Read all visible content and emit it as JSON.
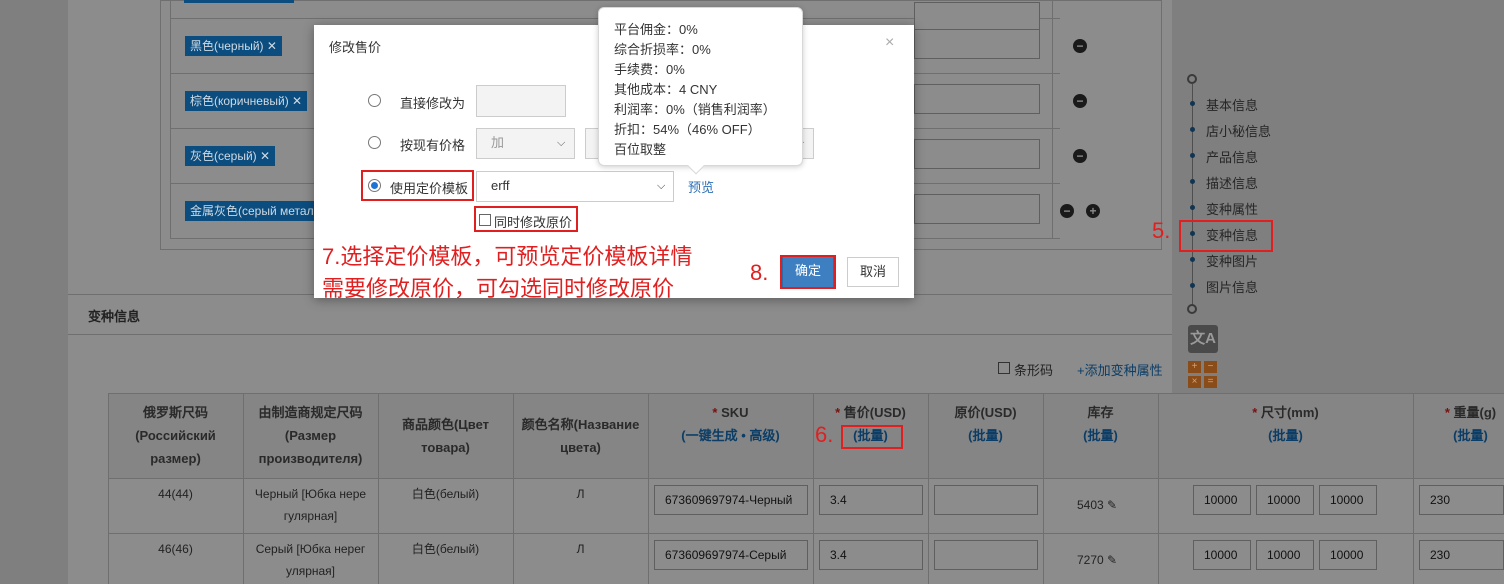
{
  "colors": {
    "accent": "#3d7fc1",
    "link": "#2c6fb5",
    "annotation": "#e02020",
    "tag_bg": "#0b4d7f",
    "overlay": "#7f7f7f"
  },
  "color_tags": [
    {
      "label": "黑色(черный)"
    },
    {
      "label": "棕色(коричневый)"
    },
    {
      "label": "灰色(серый)"
    },
    {
      "label": "金属灰色(серый метал"
    }
  ],
  "side_nav": {
    "items": [
      "基本信息",
      "店小秘信息",
      "产品信息",
      "描述信息",
      "变种属性",
      "变种信息",
      "变种图片",
      "图片信息"
    ],
    "active": "变种信息"
  },
  "variant_section": {
    "title": "变种信息",
    "barcode_label": "条形码",
    "add_attr_link": "+添加变种属性",
    "headers": [
      {
        "lines": [
          "俄罗斯尺码",
          "(Российский",
          "размер)"
        ]
      },
      {
        "lines": [
          "由制造商规定尺码",
          "(Размер",
          "производителя)"
        ]
      },
      {
        "lines": [
          "商品颜色(Цвет",
          "товара)"
        ]
      },
      {
        "lines": [
          "颜色名称(Название",
          "цвета)"
        ]
      },
      {
        "req": "*",
        "label": "SKU",
        "sub_a": "一键生成",
        "sep": "•",
        "sub_b": "高级",
        "open": "(",
        "close": ")"
      },
      {
        "req": "*",
        "label": "售价(USD)",
        "sub": "(批量)"
      },
      {
        "label": "原价(USD)",
        "sub": "(批量)"
      },
      {
        "label": "库存",
        "sub": "(批量)"
      },
      {
        "req": "*",
        "label": "尺寸(mm)",
        "sub": "(批量)"
      },
      {
        "req": "*",
        "label": "重量(g)",
        "sub": "(批量)"
      }
    ],
    "rows": [
      {
        "ru_size": "44(44)",
        "maker_size": [
          "Черный [Юбка нере",
          "гулярная]"
        ],
        "color": "白色(белый)",
        "color_name": "Л",
        "sku": "673609697974-Черный",
        "price": "3.4",
        "original": "",
        "stock": "5403",
        "dims": [
          "10000",
          "10000",
          "10000"
        ],
        "weight": "230"
      },
      {
        "ru_size": "46(46)",
        "maker_size": [
          "Серый [Юбка нерег",
          "улярная]"
        ],
        "color": "白色(белый)",
        "color_name": "Л",
        "sku": "673609697974-Серый",
        "price": "3.4",
        "original": "",
        "stock": "7270",
        "dims": [
          "10000",
          "10000",
          "10000"
        ],
        "weight": "230"
      }
    ]
  },
  "modal": {
    "title": "修改售价",
    "close": "×",
    "option_direct": "直接修改为",
    "option_existing": "按现有价格",
    "existing_op": "加",
    "option_template": "使用定价模板",
    "template_value": "erff",
    "preview_link": "预览",
    "also_original": "同时修改原价",
    "ok": "确定",
    "cancel": "取消"
  },
  "tooltip": {
    "lines": [
      "平台佣金：0%",
      "综合折损率：0%",
      "手续费：0%",
      "其他成本：4 CNY",
      "利润率：0%（销售利润率）",
      "折扣：54%（46% OFF）",
      "百位取整"
    ]
  },
  "annotations": {
    "step5": "5.",
    "step6": "6.",
    "step7_line1": "7.选择定价模板，可预览定价模板详情",
    "step7_line2": "需要修改原价，可勾选同时修改原价",
    "step8": "8."
  },
  "tools": {
    "translate_icon": "translate-icon",
    "calculator_icon": "calculator-icon"
  }
}
